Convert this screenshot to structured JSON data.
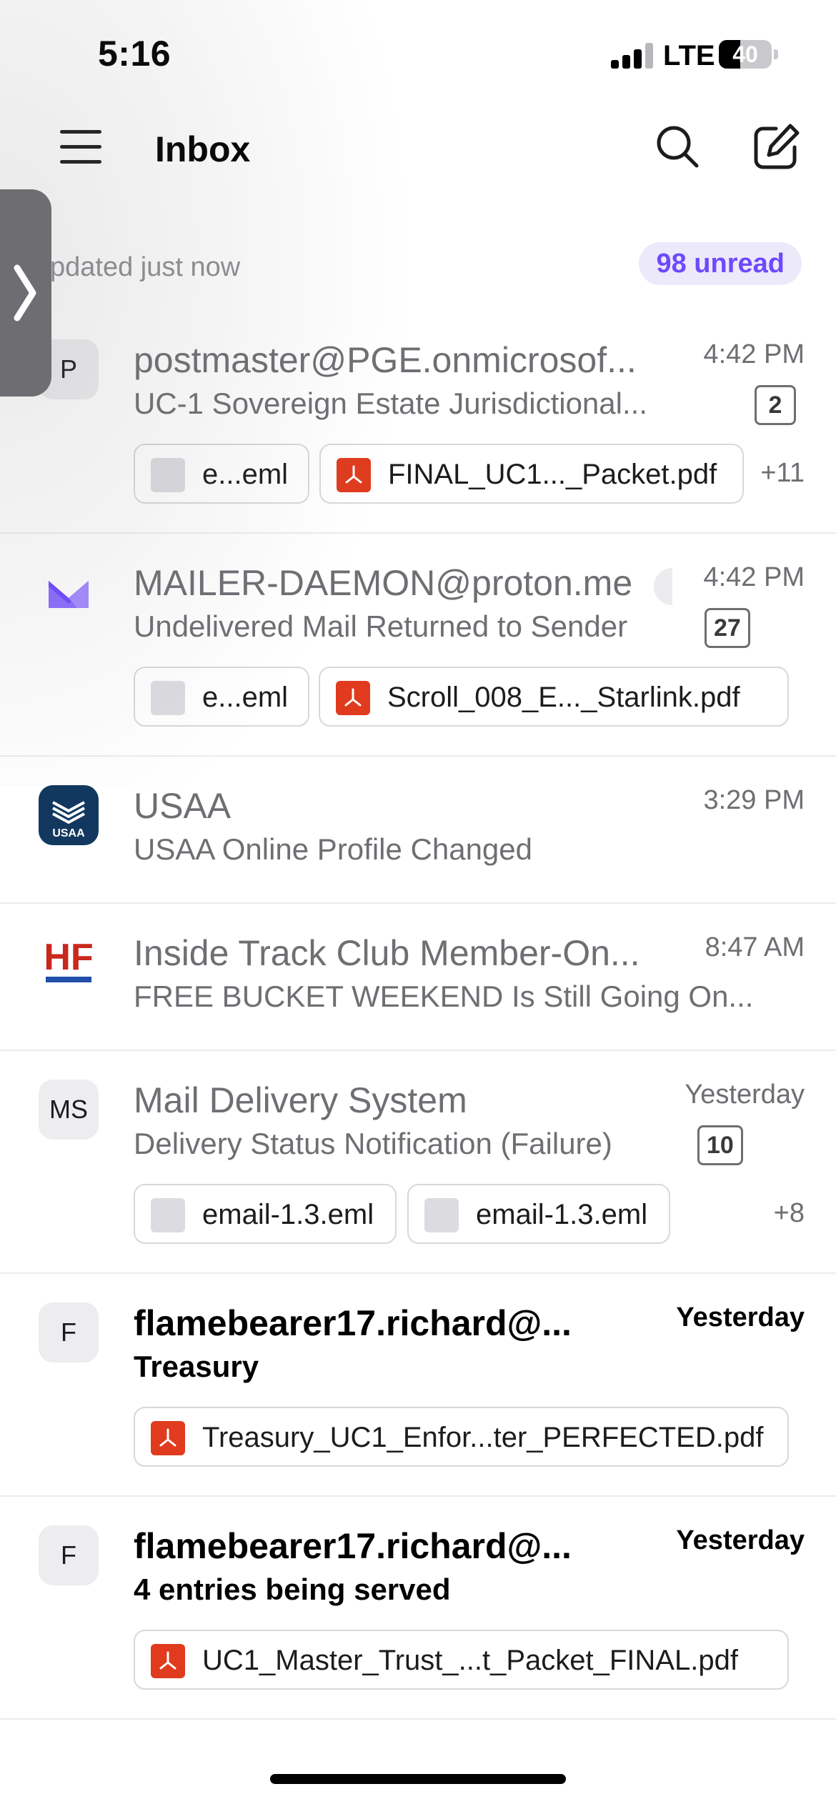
{
  "status_bar": {
    "time": "5:16",
    "network": "LTE",
    "battery": "40",
    "battery_level": 0.4
  },
  "header": {
    "title": "Inbox"
  },
  "info": {
    "updated": "pdated just now",
    "unread": "98 unread"
  },
  "emails": [
    {
      "avatar": "P",
      "sender": "postmaster@PGE.onmicrosof...",
      "time": "4:42 PM",
      "subject": "UC-1 Sovereign Estate Jurisdictional...",
      "count": "2",
      "attachments": [
        "e...eml",
        "FINAL_UC1..._Packet.pdf"
      ],
      "more": "+11",
      "unread": false
    },
    {
      "avatar": "",
      "sender": "MAILER-DAEMON@proton.me",
      "time": "4:42 PM",
      "subject": "Undelivered Mail Returned to Sender",
      "count": "27",
      "attachments": [
        "e...eml",
        "Scroll_008_E..._Starlink.pdf"
      ],
      "more": "",
      "unread": false
    },
    {
      "avatar": "USAA",
      "sender": "USAA",
      "time": "3:29 PM",
      "subject": "USAA Online Profile Changed",
      "count": "",
      "attachments": [],
      "more": "",
      "unread": false
    },
    {
      "avatar": "HF",
      "sender": "Inside Track Club Member-On...",
      "time": "8:47 AM",
      "subject": "FREE BUCKET WEEKEND Is Still Going On...",
      "count": "",
      "attachments": [],
      "more": "",
      "unread": false
    },
    {
      "avatar": "MS",
      "sender": "Mail Delivery System",
      "time": "Yesterday",
      "subject": "Delivery Status Notification (Failure)",
      "count": "10",
      "attachments": [
        "email-1.3.eml",
        "email-1.3.eml"
      ],
      "more": "+8",
      "unread": false
    },
    {
      "avatar": "F",
      "sender": "flamebearer17.richard@...",
      "time": "Yesterday",
      "subject": "Treasury",
      "count": "",
      "attachments": [
        "Treasury_UC1_Enfor...ter_PERFECTED.pdf"
      ],
      "more": "",
      "unread": true
    },
    {
      "avatar": "F",
      "sender": "flamebearer17.richard@...",
      "time": "Yesterday",
      "subject": "4 entries being served",
      "count": "",
      "attachments": [
        "UC1_Master_Trust_...t_Packet_FINAL.pdf"
      ],
      "more": "",
      "unread": true
    }
  ],
  "colors": {
    "accent": "#6d4aff",
    "pdf": "#e03b1e",
    "usaa": "#12385f",
    "hf_red": "#c8281e",
    "hf_blue": "#1f4fa8"
  },
  "icons": [
    "menu-icon",
    "search-icon",
    "compose-icon",
    "chevron-right-icon",
    "proton-mail-logo",
    "pdf-icon",
    "file-icon"
  ]
}
